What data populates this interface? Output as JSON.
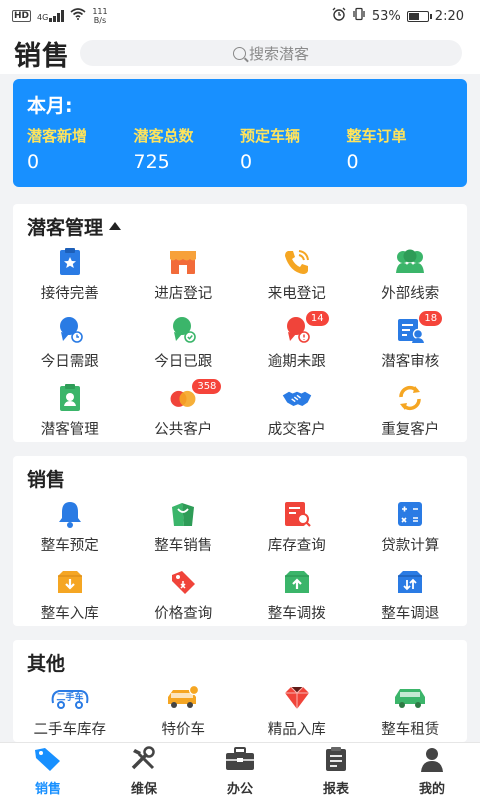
{
  "status_bar": {
    "hd": "HD",
    "network": "4G",
    "speed_value": "111",
    "speed_unit": "B/s",
    "battery": "53%",
    "time": "2:20"
  },
  "header": {
    "title": "销售",
    "search_placeholder": "搜索潜客"
  },
  "month": {
    "title": "本月:",
    "stats": [
      {
        "label": "潜客新增",
        "value": "0"
      },
      {
        "label": "潜客总数",
        "value": "725"
      },
      {
        "label": "预定车辆",
        "value": "0"
      },
      {
        "label": "整车订单",
        "value": "0"
      }
    ]
  },
  "sections": {
    "prospects": {
      "title": "潜客管理",
      "items": [
        {
          "label": "接待完善",
          "icon": "reception-icon"
        },
        {
          "label": "进店登记",
          "icon": "store-icon"
        },
        {
          "label": "来电登记",
          "icon": "phone-icon"
        },
        {
          "label": "外部线索",
          "icon": "leads-icon"
        },
        {
          "label": "今日需跟",
          "icon": "today-follow-icon"
        },
        {
          "label": "今日已跟",
          "icon": "followed-icon"
        },
        {
          "label": "逾期未跟",
          "icon": "overdue-icon",
          "badge": "14"
        },
        {
          "label": "潜客审核",
          "icon": "review-icon",
          "badge": "18"
        },
        {
          "label": "潜客管理",
          "icon": "manage-icon"
        },
        {
          "label": "公共客户",
          "icon": "public-customer-icon",
          "badge": "358"
        },
        {
          "label": "成交客户",
          "icon": "handshake-icon"
        },
        {
          "label": "重复客户",
          "icon": "repeat-icon"
        }
      ]
    },
    "sales": {
      "title": "销售",
      "items": [
        {
          "label": "整车预定",
          "icon": "bell-icon"
        },
        {
          "label": "整车销售",
          "icon": "bag-icon"
        },
        {
          "label": "库存查询",
          "icon": "inventory-search-icon"
        },
        {
          "label": "贷款计算",
          "icon": "calculator-icon"
        },
        {
          "label": "整车入库",
          "icon": "box-in-icon"
        },
        {
          "label": "价格查询",
          "icon": "price-tag-icon"
        },
        {
          "label": "整车调拨",
          "icon": "transfer-icon"
        },
        {
          "label": "整车调退",
          "icon": "return-icon"
        }
      ]
    },
    "other": {
      "title": "其他",
      "items": [
        {
          "label": "二手车库存",
          "icon": "used-car-icon",
          "icon_text": "二手车"
        },
        {
          "label": "特价车",
          "icon": "special-car-icon"
        },
        {
          "label": "精品入库",
          "icon": "gem-icon"
        },
        {
          "label": "整车租赁",
          "icon": "car-rental-icon"
        }
      ]
    }
  },
  "tabbar": [
    {
      "label": "销售",
      "icon": "tag-icon",
      "active": true
    },
    {
      "label": "维保",
      "icon": "tools-icon"
    },
    {
      "label": "办公",
      "icon": "briefcase-icon"
    },
    {
      "label": "报表",
      "icon": "clipboard-icon"
    },
    {
      "label": "我的",
      "icon": "person-icon"
    }
  ],
  "colors": {
    "accent": "#1890ff",
    "stat_label": "#ffe45c",
    "badge": "#f5443a"
  }
}
